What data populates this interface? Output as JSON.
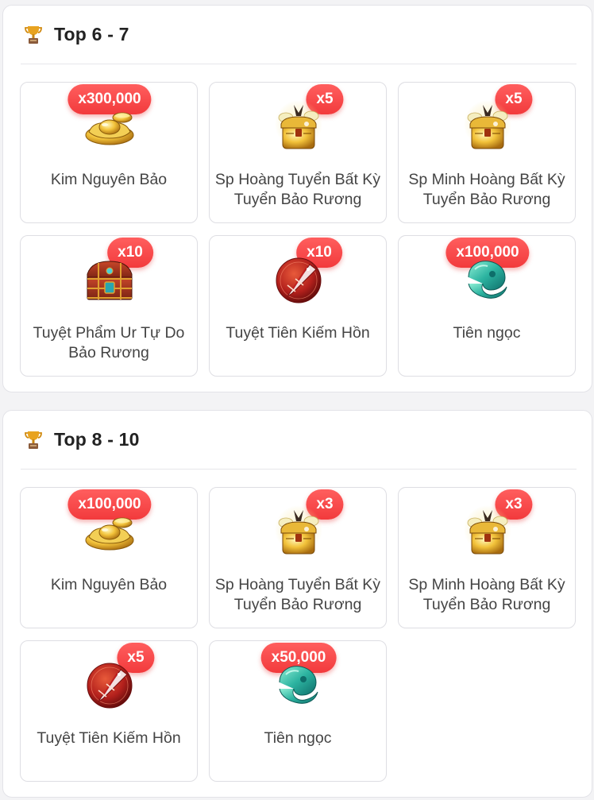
{
  "sections": [
    {
      "title": "Top 6 - 7",
      "items": [
        {
          "name": "Kim Nguyên Bảo",
          "qty": "x300,000",
          "icon": "gold-ingot-icon"
        },
        {
          "name": "Sp Hoàng Tuyển Bất Kỳ Tuyển Bảo Rương",
          "qty": "x5",
          "icon": "treasure-chest-icon"
        },
        {
          "name": "Sp Minh Hoàng Bất Kỳ Tuyển Bảo Rương",
          "qty": "x5",
          "icon": "treasure-chest-icon"
        },
        {
          "name": "Tuyệt Phẩm Ur Tự Do Bảo Rương",
          "qty": "x10",
          "icon": "ornate-chest-icon"
        },
        {
          "name": "Tuyệt Tiên Kiếm Hồn",
          "qty": "x10",
          "icon": "sword-soul-icon"
        },
        {
          "name": "Tiên ngọc",
          "qty": "x100,000",
          "icon": "jade-icon"
        }
      ]
    },
    {
      "title": "Top 8 - 10",
      "items": [
        {
          "name": "Kim Nguyên Bảo",
          "qty": "x100,000",
          "icon": "gold-ingot-icon"
        },
        {
          "name": "Sp Hoàng Tuyển Bất Kỳ Tuyển Bảo Rương",
          "qty": "x3",
          "icon": "treasure-chest-icon"
        },
        {
          "name": "Sp Minh Hoàng Bất Kỳ Tuyển Bảo Rương",
          "qty": "x3",
          "icon": "treasure-chest-icon"
        },
        {
          "name": "Tuyệt Tiên Kiếm Hồn",
          "qty": "x5",
          "icon": "sword-soul-icon"
        },
        {
          "name": "Tiên ngọc",
          "qty": "x50,000",
          "icon": "jade-icon"
        }
      ]
    }
  ],
  "colors": {
    "badge": "#f23a3c",
    "border": "#dedee3",
    "title": "#222222",
    "text": "#444444"
  }
}
